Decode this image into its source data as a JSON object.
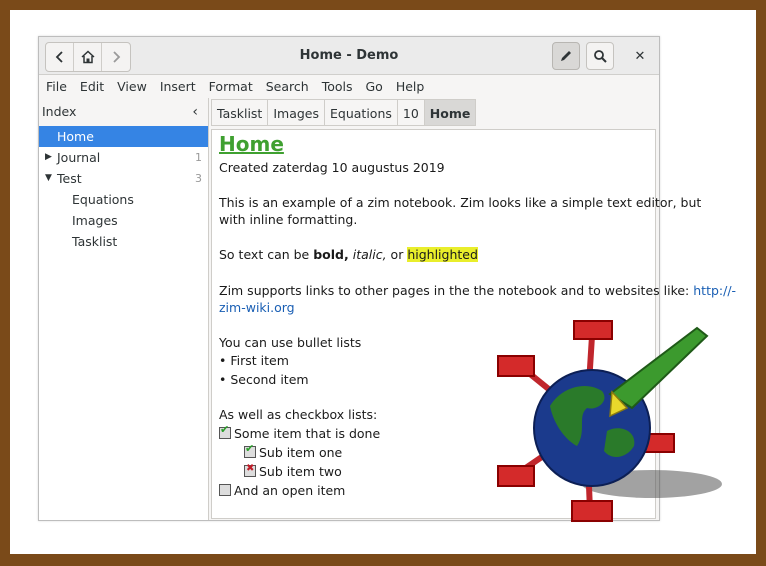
{
  "window": {
    "title": "Home - Demo"
  },
  "menu": [
    "File",
    "Edit",
    "View",
    "Insert",
    "Format",
    "Search",
    "Tools",
    "Go",
    "Help"
  ],
  "sidebar": {
    "header": "Index",
    "tree": [
      {
        "label": "Home",
        "selected": true,
        "level": 0
      },
      {
        "label": "Journal",
        "level": 0,
        "expander": "collapsed",
        "count": "1"
      },
      {
        "label": "Test",
        "level": 0,
        "expander": "expanded",
        "count": "3"
      },
      {
        "label": "Equations",
        "level": 1
      },
      {
        "label": "Images",
        "level": 1
      },
      {
        "label": "Tasklist",
        "level": 1
      }
    ]
  },
  "pathbar": [
    "Tasklist",
    "Images",
    "Equations",
    "10",
    "Home"
  ],
  "page": {
    "heading": "Home",
    "created": "Created zaterdag 10 augustus 2019",
    "intro1": "This is an example of a zim notebook. Zim looks like a simple text editor, but",
    "intro2": "with inline formatting.",
    "fmt_prefix": "So text can be ",
    "fmt_bold": "bold,",
    "fmt_italic": "italic,",
    "fmt_or": " or ",
    "fmt_highlight": "highlighted",
    "links_text": "Zim supports links to other pages in the the notebook and to websites like: ",
    "link_part1": "http://-",
    "link_part2": "zim-wiki.org",
    "bullets_intro": "You can use bullet lists",
    "bullets": [
      "• First item",
      "• Second item"
    ],
    "checkbox_intro": "As well as checkbox lists:",
    "checkboxes": [
      {
        "label": "Some item that is done",
        "state": "done",
        "indent": 0
      },
      {
        "label": "Sub item one",
        "state": "done",
        "indent": 1
      },
      {
        "label": "Sub item two",
        "state": "x",
        "indent": 1
      },
      {
        "label": "And an open item",
        "state": "open",
        "indent": 0
      }
    ]
  },
  "colors": {
    "accent": "#3584e4",
    "heading": "#3fa030",
    "link": "#1a5fb4",
    "highlight": "#e9ee2b",
    "frame": "#7a4a19"
  }
}
